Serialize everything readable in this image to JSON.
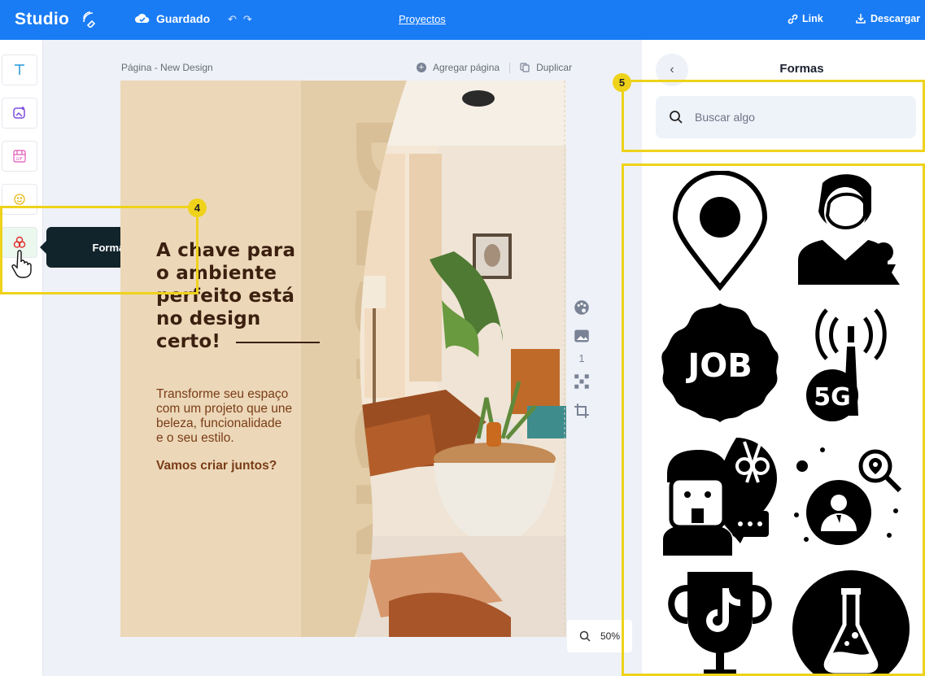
{
  "topbar": {
    "logo": "Studio",
    "status": "Guardado",
    "projects": "Proyectos",
    "link": "Link",
    "download": "Descargar"
  },
  "sidebar": {
    "tools": [
      {
        "name": "text-tool",
        "icon": "text-icon"
      },
      {
        "name": "image-tool",
        "icon": "image-plus-icon"
      },
      {
        "name": "gif-tool",
        "icon": "gif-icon"
      },
      {
        "name": "emoji-tool",
        "icon": "smiley-icon"
      },
      {
        "name": "shapes-tool",
        "icon": "shapes-icon"
      }
    ],
    "tooltip": "Formas"
  },
  "canvas": {
    "page_label": "Página - New Design",
    "add_page": "Agregar página",
    "duplicate": "Duplicar",
    "page_number": "1",
    "zoom": "50%"
  },
  "design": {
    "headline_line1": "A chave para",
    "headline_line2": "o ambiente",
    "headline_line3": "perfeito está",
    "headline_line4": "no design",
    "headline_line5": "certo!",
    "body_line1": "Transforme seu espaço",
    "body_line2": "com um projeto que une",
    "body_line3": "beleza, funcionalidade",
    "body_line4": "e o seu estilo.",
    "cta": "Vamos criar juntos?",
    "bg_word": "DESIGN"
  },
  "panel": {
    "title": "Formas",
    "search_placeholder": "Buscar algo",
    "shape_text_job": "JOB",
    "shape_text_5g": "5G",
    "shapes": [
      "map-pin-icon",
      "businessman-chess-icon",
      "job-badge-icon",
      "5g-antenna-icon",
      "barber-location-icon",
      "user-search-icon",
      "tiktok-trophy-icon",
      "flask-icon"
    ]
  },
  "annotations": {
    "badge4": "4",
    "badge5": "5"
  },
  "colors": {
    "topbar": "#1a7cf5",
    "highlight": "#efd21a",
    "page_bg": "#ecd8b8",
    "headline": "#3b1f0f",
    "body": "#7a3c18"
  }
}
